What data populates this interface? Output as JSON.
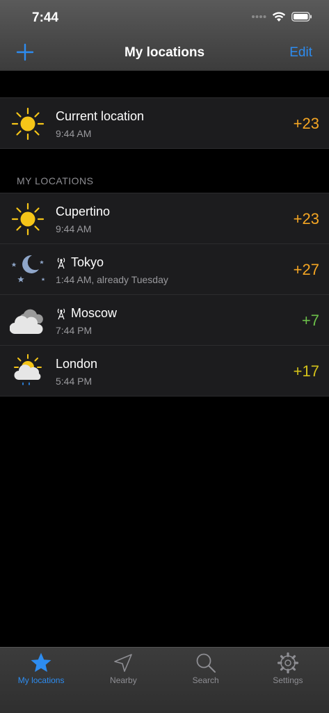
{
  "status_bar": {
    "time": "7:44"
  },
  "nav": {
    "title": "My locations",
    "edit_label": "Edit"
  },
  "current": {
    "name": "Current location",
    "time": "9:44 AM",
    "temp": "+23",
    "temp_color": "#f5a623",
    "icon": "sun-icon"
  },
  "section_header": "MY LOCATIONS",
  "locations": [
    {
      "name": "Cupertino",
      "time": "9:44 AM",
      "temp": "+23",
      "temp_color": "#f5a623",
      "icon": "sun-icon",
      "tower": false
    },
    {
      "name": "Tokyo",
      "time": "1:44 AM, already Tuesday",
      "temp": "+27",
      "temp_color": "#f5a623",
      "icon": "moon-stars-icon",
      "tower": true
    },
    {
      "name": "Moscow",
      "time": "7:44 PM",
      "temp": "+7",
      "temp_color": "#6cc04a",
      "icon": "cloud-icon",
      "tower": true
    },
    {
      "name": "London",
      "time": "5:44 PM",
      "temp": "+17",
      "temp_color": "#d4c21a",
      "icon": "sun-cloud-rain-icon",
      "tower": false
    }
  ],
  "tabs": [
    {
      "label": "My locations",
      "icon": "star-icon",
      "active": true
    },
    {
      "label": "Nearby",
      "icon": "location-arrow-icon",
      "active": false
    },
    {
      "label": "Search",
      "icon": "search-icon",
      "active": false
    },
    {
      "label": "Settings",
      "icon": "gear-icon",
      "active": false
    }
  ],
  "colors": {
    "accent": "#2d8cf0",
    "sun": "#f5c518"
  }
}
